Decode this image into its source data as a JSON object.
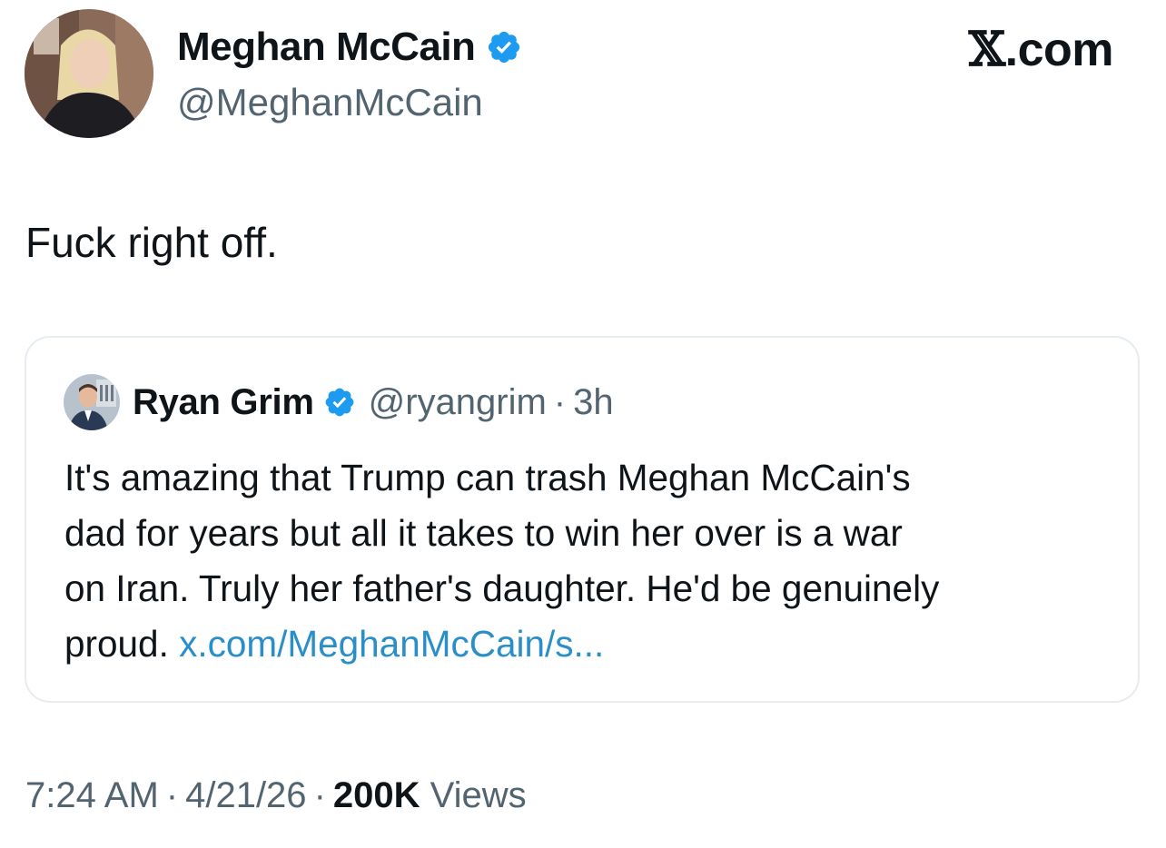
{
  "tweet": {
    "author": {
      "name": "Meghan McCain",
      "handle": "@MeghanMcCain",
      "verified": true
    },
    "site": {
      "prefix": "𝕏",
      "suffix": ".com"
    },
    "text": "Fuck right off.",
    "quoted": {
      "author": {
        "name": "Ryan Grim",
        "handle": "@ryangrim",
        "separator": "·",
        "time": "3h",
        "verified": true
      },
      "lines": [
        "It's amazing that Trump can trash Meghan McCain's",
        "dad for years but all it takes to win her over is a war",
        "on Iran. Truly her father's daughter. He'd be genuinely"
      ],
      "last_line_text": "proud.",
      "link_text": "x.com/MeghanMcCain/s..."
    },
    "meta": {
      "time": "7:24 AM",
      "sep1": "·",
      "date": "4/21/26",
      "sep2": "·",
      "views_count": "200K",
      "views_label": "Views"
    }
  },
  "colors": {
    "text": "#0f1419",
    "secondary": "#536471",
    "link": "#2a8fc9",
    "verified": "#1d9bf0",
    "card_border": "#e6ecf0"
  },
  "icons": {
    "verified": "verified-badge-icon"
  }
}
